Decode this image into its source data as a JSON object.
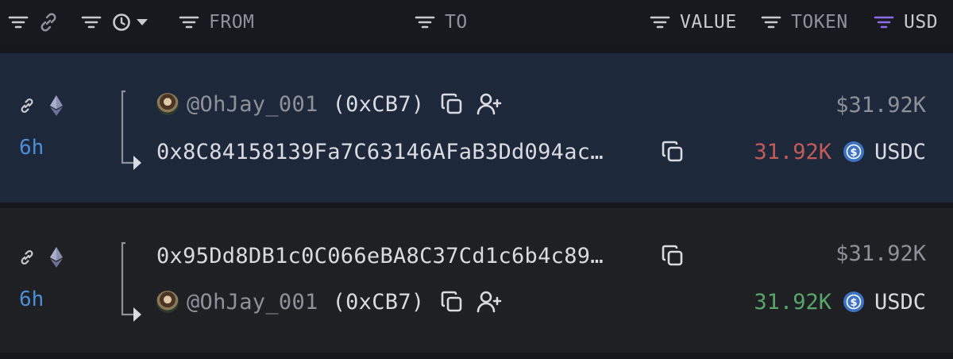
{
  "header": {
    "from_label": "FROM",
    "to_label": "TO",
    "value_label": "VALUE",
    "token_label": "TOKEN",
    "usd_label": "USD",
    "accent_color": "#8d6be8",
    "icons": [
      "filter-icon",
      "link-icon",
      "clock-icon",
      "caret-down-icon"
    ]
  },
  "transfers": [
    {
      "time": "6h",
      "from": {
        "name": "@OhJay_001",
        "short": "(0xCB7)"
      },
      "to": {
        "address": "0x8C84158139Fa7C63146AFaB3Dd094ac…"
      },
      "usd": "$31.92K",
      "amount": "31.92K",
      "direction": "out",
      "token": "USDC",
      "amount_color": "#c25b58"
    },
    {
      "time": "6h",
      "from": {
        "address": "0x95Dd8DB1c0C066eBA8C37Cd1c6b4c89…"
      },
      "to": {
        "name": "@OhJay_001",
        "short": "(0xCB7)"
      },
      "usd": "$31.92K",
      "amount": "31.92K",
      "direction": "in",
      "token": "USDC",
      "amount_color": "#58a66a"
    }
  ]
}
